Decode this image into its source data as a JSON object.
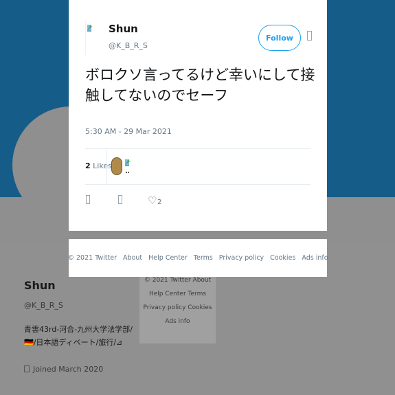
{
  "tweet": {
    "author_name": "Shun",
    "author_handle": "@K_B_R_S",
    "follow_label": "Follow",
    "text": "ボロクソ言ってるけど幸いにして接触してないのでセーフ",
    "timestamp": "5:30 AM - 29 Mar 2021",
    "likes_number": "2",
    "likes_label": "Likes",
    "like_count": "2"
  },
  "footer": {
    "copyright": "© 2021 Twitter",
    "about": "About",
    "help_center": "Help Center",
    "terms": "Terms",
    "privacy": "Privacy policy",
    "cookies": "Cookies",
    "ads_info": "Ads info"
  },
  "profile": {
    "name": "Shun",
    "handle": "@K_B_R_S",
    "bio": "青雲43rd-河合-九州大学法学部/🇩🇪/日本語ディベート/旅行/⊿",
    "joined": "Joined March 2020"
  },
  "colors": {
    "banner": "#155c88",
    "accent": "#1da1f2"
  }
}
